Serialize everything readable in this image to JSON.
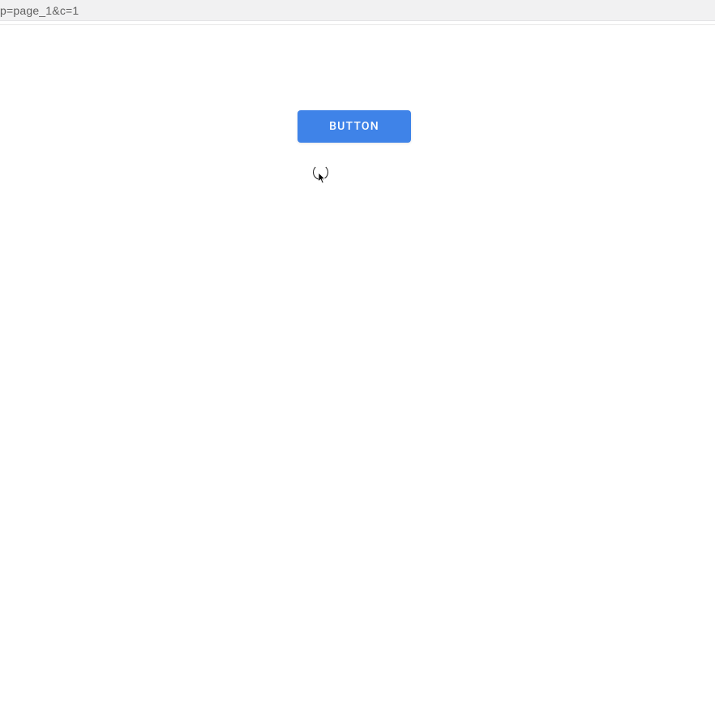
{
  "browser": {
    "url_fragment": "p=page_1&c=1"
  },
  "main": {
    "button_label": "BUTTON"
  },
  "colors": {
    "button_bg": "#3f83e8",
    "button_text": "#ffffff"
  }
}
